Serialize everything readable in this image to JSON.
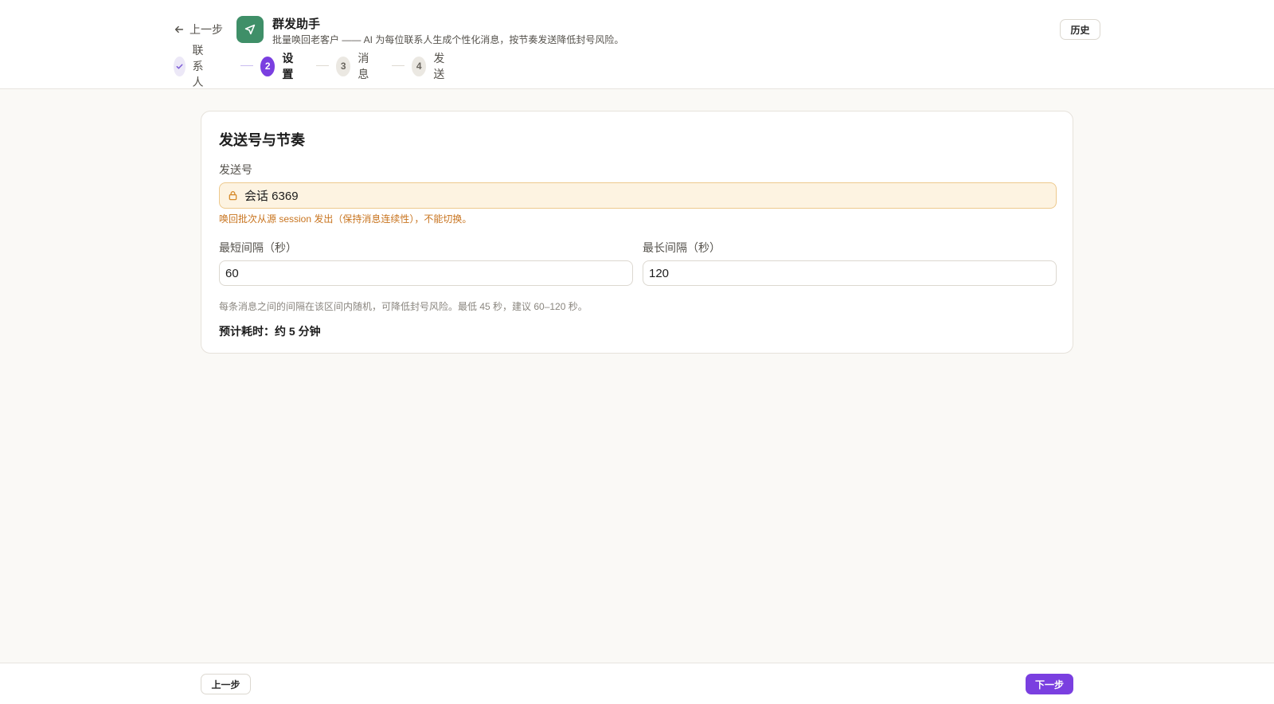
{
  "header": {
    "back_label": "上一步",
    "app_title": "群发助手",
    "app_subtitle": "批量唤回老客户 —— AI 为每位联系人生成个性化消息，按节奏发送降低封号风险。",
    "history_label": "历史",
    "logo_icon": "send-arrow-icon",
    "logo_color": "#3f8f68"
  },
  "stepper": {
    "steps": [
      {
        "number": "✓",
        "label": "联系人",
        "state": "done"
      },
      {
        "number": "2",
        "label": "设置",
        "state": "active"
      },
      {
        "number": "3",
        "label": "消息",
        "state": "todo"
      },
      {
        "number": "4",
        "label": "发送",
        "state": "todo"
      }
    ],
    "accent_color": "#7a3fe0"
  },
  "card": {
    "title": "发送号与节奏",
    "sender_label": "发送号",
    "sender_value": "会话 6369",
    "sender_lock_hint": "唤回批次从源 session 发出（保持消息连续性），不能切换。",
    "min_interval_label": "最短间隔（秒）",
    "min_interval_value": "60",
    "max_interval_label": "最长间隔（秒）",
    "max_interval_value": "120",
    "interval_hint": "每条消息之间的间隔在该区间内随机，可降低封号风险。最低 45 秒，建议 60–120 秒。",
    "estimate": "预计耗时：约 5 分钟"
  },
  "footer": {
    "prev_label": "上一步",
    "next_label": "下一步"
  }
}
